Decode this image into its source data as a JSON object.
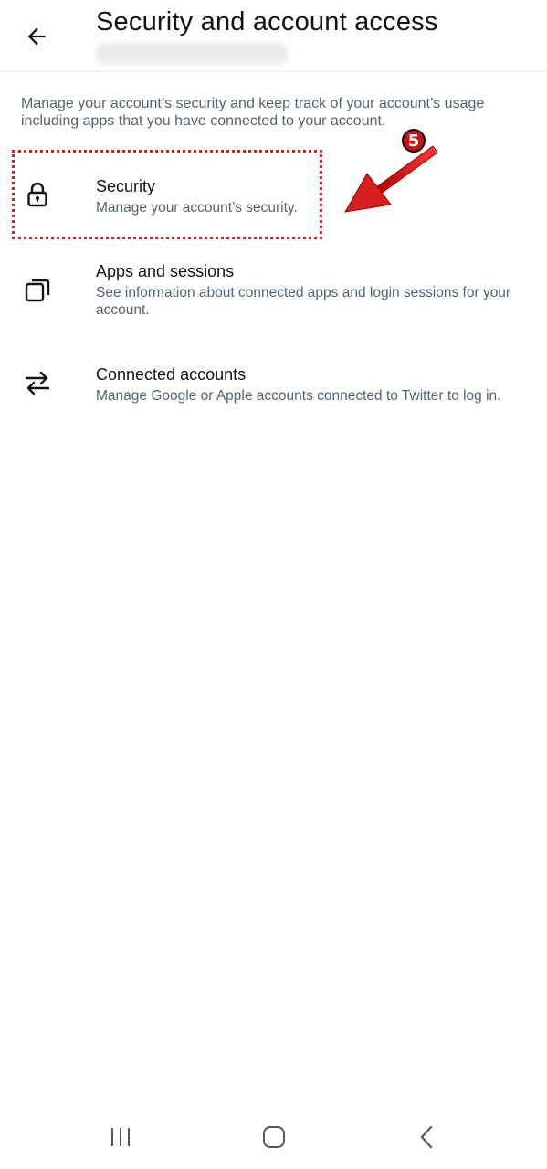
{
  "header": {
    "back_icon": "arrow-left-icon",
    "title": "Security and account access"
  },
  "intro": "Manage your account’s security and keep track of your account’s usage including apps that you have connected to your account.",
  "items": [
    {
      "icon": "lock-icon",
      "title": "Security",
      "description": "Manage your account’s security."
    },
    {
      "icon": "copy-windows-icon",
      "title": "Apps and sessions",
      "description": "See information about connected apps and login sessions for your account."
    },
    {
      "icon": "swap-arrows-icon",
      "title": "Connected accounts",
      "description": "Manage Google or Apple accounts connected to Twitter to log in."
    }
  ],
  "annotation": {
    "step_number": "5",
    "color": "#d71f1f"
  },
  "navbar": {
    "recents_icon": "recent-apps-icon",
    "home_icon": "home-icon",
    "back_icon": "nav-back-icon"
  }
}
